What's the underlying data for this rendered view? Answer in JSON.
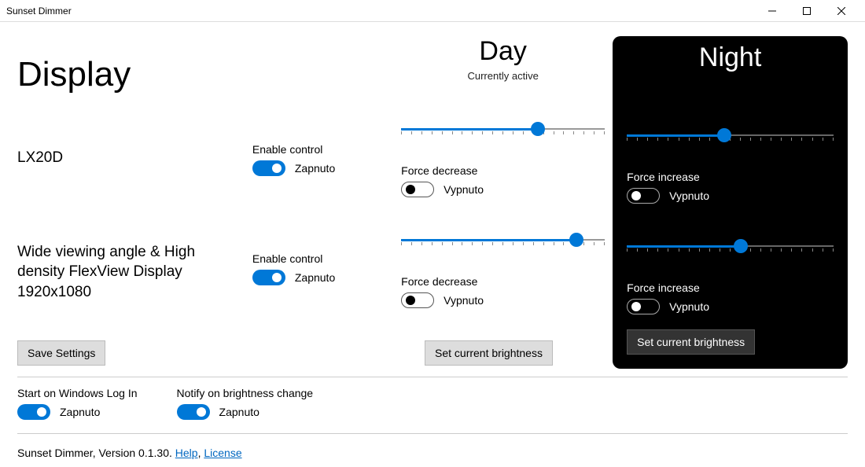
{
  "window": {
    "title": "Sunset Dimmer"
  },
  "page": {
    "title": "Display"
  },
  "profiles": {
    "day": {
      "title": "Day",
      "subtitle": "Currently active"
    },
    "night": {
      "title": "Night",
      "subtitle": ""
    }
  },
  "enable_control_label": "Enable control",
  "force_decrease_label": "Force decrease",
  "force_increase_label": "Force increase",
  "state_on": "Zapnuto",
  "state_off": "Vypnuto",
  "displays": [
    {
      "name": "LX20D",
      "enabled": true,
      "day": {
        "brightness": 67,
        "force_decrease": false
      },
      "night": {
        "brightness": 47,
        "force_increase": false
      }
    },
    {
      "name": "Wide viewing angle & High density FlexView Display 1920x1080",
      "enabled": true,
      "day": {
        "brightness": 86,
        "force_decrease": false
      },
      "night": {
        "brightness": 55,
        "force_increase": false
      }
    }
  ],
  "buttons": {
    "save": "Save Settings",
    "set_current_day": "Set current brightness",
    "set_current_night": "Set current brightness"
  },
  "footer": {
    "start_on_login_label": "Start on Windows Log In",
    "start_on_login": true,
    "notify_label": "Notify on brightness change",
    "notify": true,
    "version_prefix": "Sunset Dimmer, Version 0.1.30. ",
    "help": "Help",
    "license": "License"
  }
}
